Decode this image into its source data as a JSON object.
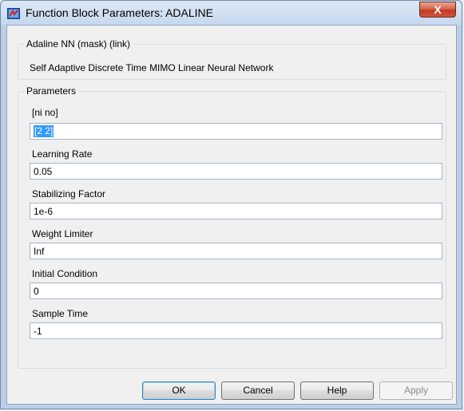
{
  "window": {
    "title": "Function Block Parameters: ADALINE",
    "close_glyph": "X"
  },
  "mask": {
    "group_title": "Adaline NN (mask) (link)",
    "description": "Self Adaptive Discrete Time MIMO Linear Neural Network"
  },
  "parameters": {
    "group_title": "Parameters",
    "fields": [
      {
        "label": "[ni no]",
        "value": "[2 2]"
      },
      {
        "label": "Learning Rate",
        "value": "0.05"
      },
      {
        "label": "Stabilizing Factor",
        "value": "1e-6"
      },
      {
        "label": "Weight Limiter",
        "value": "Inf"
      },
      {
        "label": "Initial Condition",
        "value": "0"
      },
      {
        "label": "Sample Time",
        "value": "-1"
      }
    ]
  },
  "buttons": {
    "ok": "OK",
    "cancel": "Cancel",
    "help": "Help",
    "apply": "Apply"
  },
  "icons": {
    "app": "simulink-block-icon",
    "close": "close-icon"
  }
}
